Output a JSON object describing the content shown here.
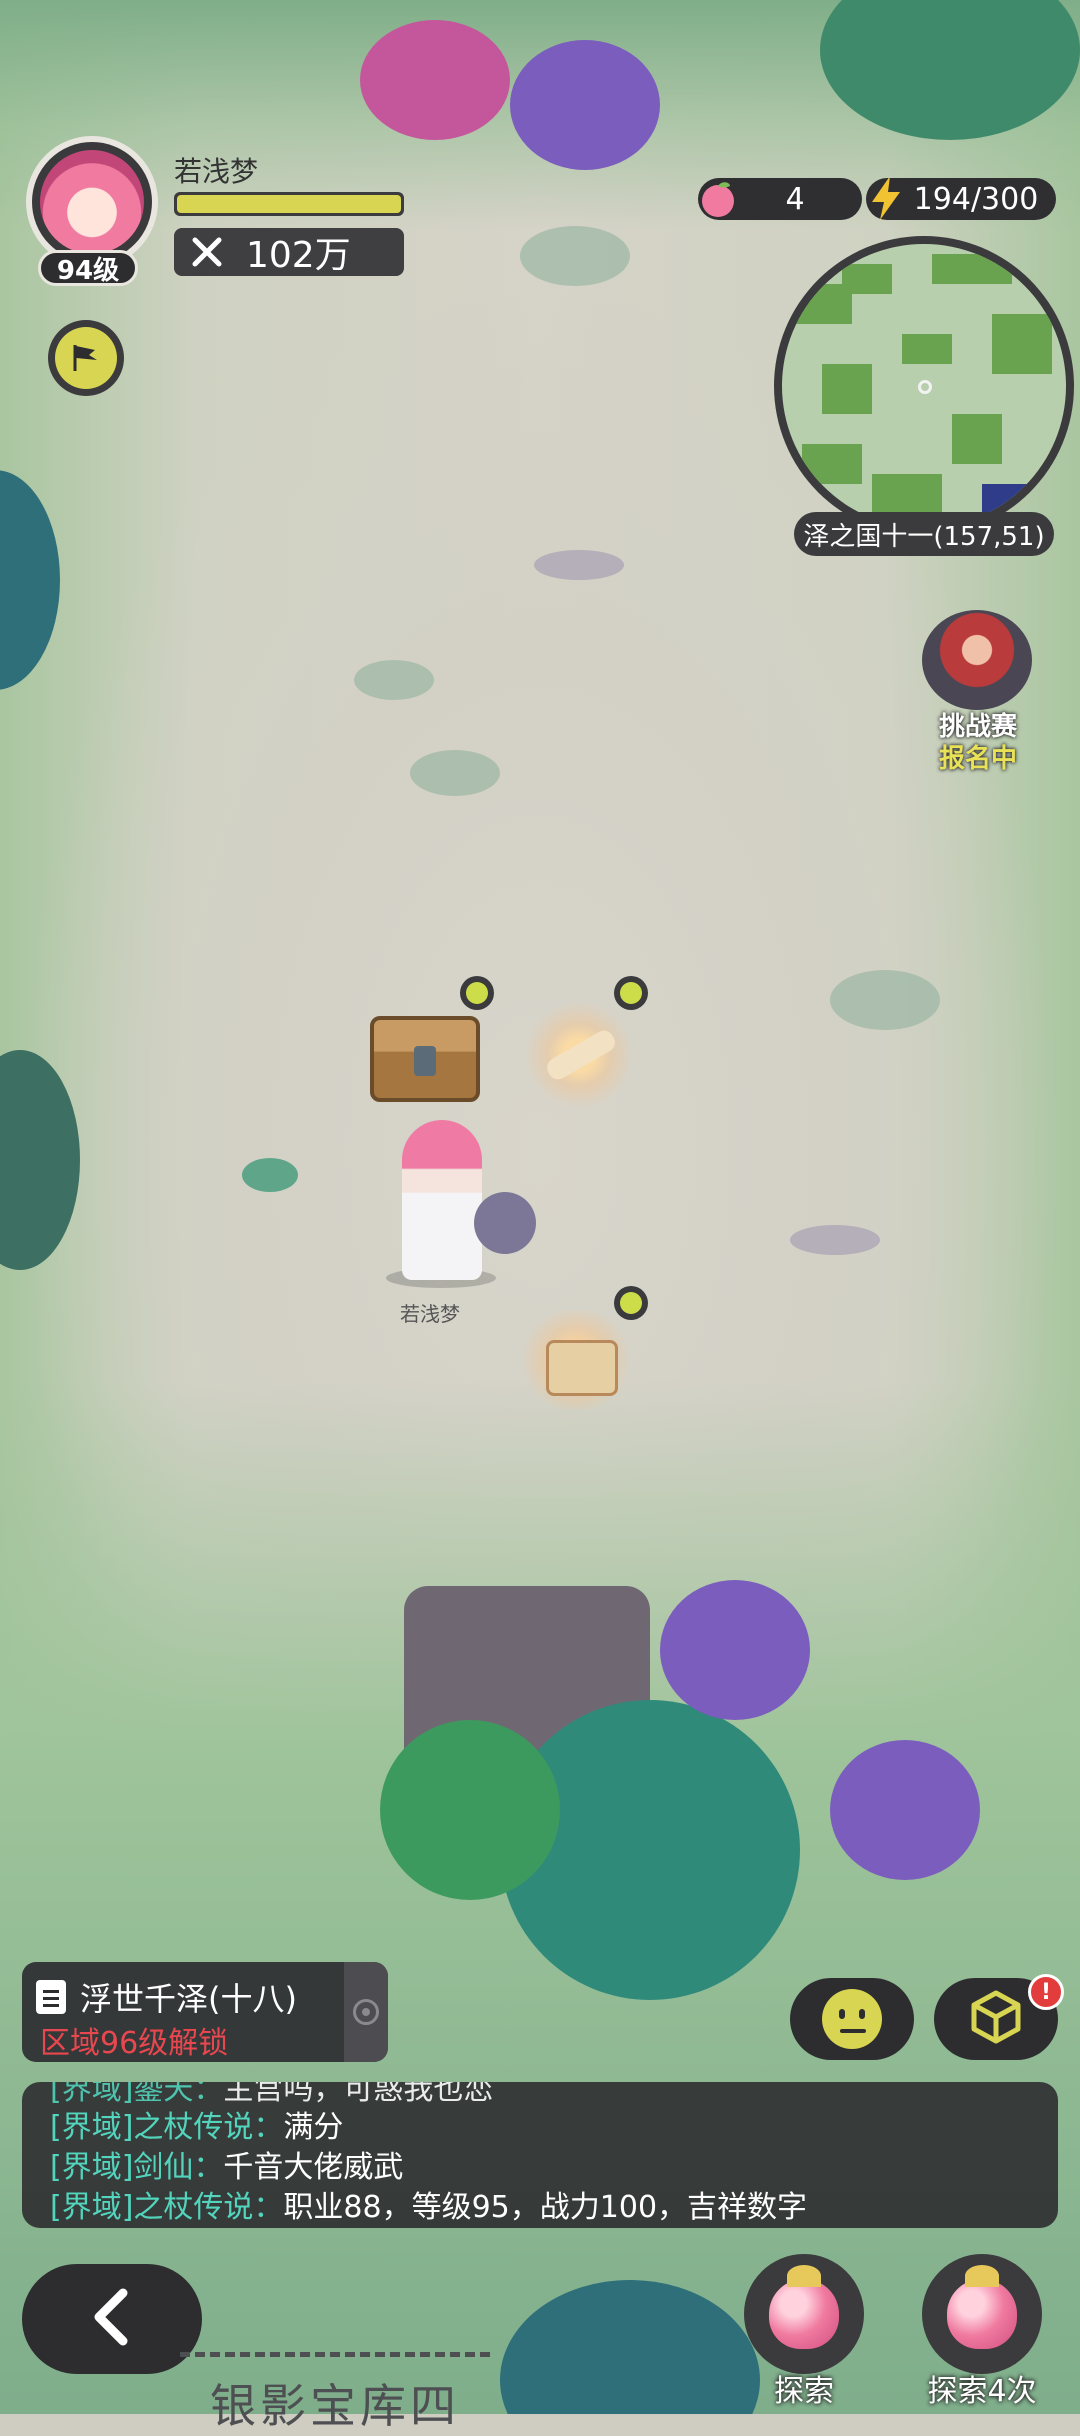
{
  "player": {
    "name": "若浅梦",
    "level": "94级",
    "hp_fraction": 1.0,
    "power": "102万"
  },
  "resources": {
    "apples": "4",
    "energy_current": "194",
    "energy_max": "/300"
  },
  "minimap": {
    "location": "泽之国十一(157,51)"
  },
  "event": {
    "title": "挑战赛",
    "status": "报名中"
  },
  "map_objects": {
    "hero_name": "若浅梦"
  },
  "quest": {
    "title": "浮世千泽(十八)",
    "lock_text": "区域96级解锁"
  },
  "chat": {
    "messages": [
      {
        "channel": "[界域]鎏天：",
        "text": "主宫吗，可惑我也恋"
      },
      {
        "channel": "[界域]之杖传说：",
        "text": "满分"
      },
      {
        "channel": "[界域]剑仙：",
        "text": "千音大佬威武"
      },
      {
        "channel": "[界域]之杖传说：",
        "text": "职业88，等级95，战力100，吉祥数字"
      }
    ]
  },
  "actions": {
    "explore_label": "探索",
    "explore4_label": "探索4次",
    "box_alert": "!"
  },
  "bottom": {
    "vault_text": "银影宝库四"
  },
  "colors": {
    "accent_yellow": "#d8d552",
    "chat_channel": "#52d4bd",
    "lock_red": "#e9474f",
    "panel_dark": "#2d2d30"
  }
}
